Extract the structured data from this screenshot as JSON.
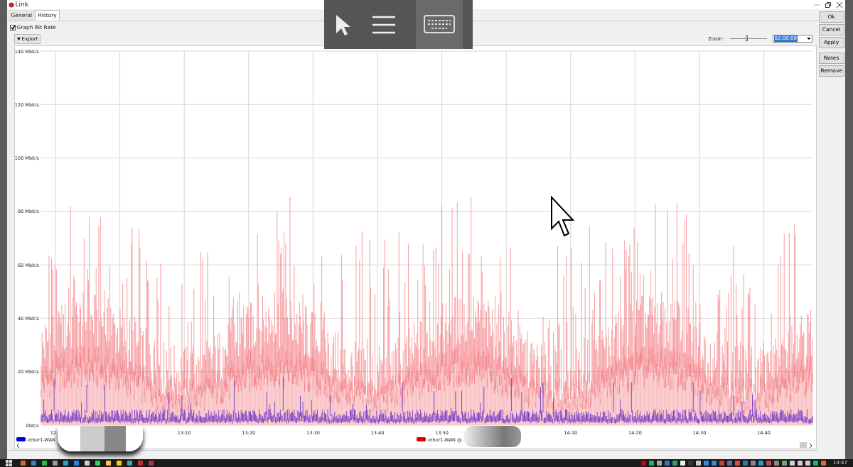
{
  "window": {
    "title": "Link"
  },
  "tabs": [
    {
      "label": "General",
      "selected": false
    },
    {
      "label": "History",
      "selected": true
    }
  ],
  "graph_bit_rate": {
    "label": "Graph Bit Rate",
    "checked": true
  },
  "export_button": {
    "label": "Export"
  },
  "zoom": {
    "label": "Zoom:",
    "level": 0.45,
    "value": "02:00:00"
  },
  "side_buttons": [
    "Ok",
    "Cancel",
    "Apply",
    "Notes",
    "Remove"
  ],
  "graph": {
    "y_labels": [
      "140 Mbit/s",
      "120 Mbit/s",
      "100 Mbit/s",
      "80 Mbit/s",
      "60 Mbit/s",
      "40 Mbit/s",
      "20 Mbit/s",
      "0bit/s"
    ],
    "x_labels": [
      "12",
      "13:10",
      "13:20",
      "13:30",
      "13:40",
      "13:50",
      "14:10",
      "14:20",
      "14:30",
      "14:40"
    ],
    "legend": [
      {
        "label": "ether1-WAN",
        "color": "#0000cc"
      },
      {
        "label": "ether1-WAN @",
        "color": "#dd0000"
      }
    ]
  },
  "taskbar": {
    "time": "14:47"
  }
}
